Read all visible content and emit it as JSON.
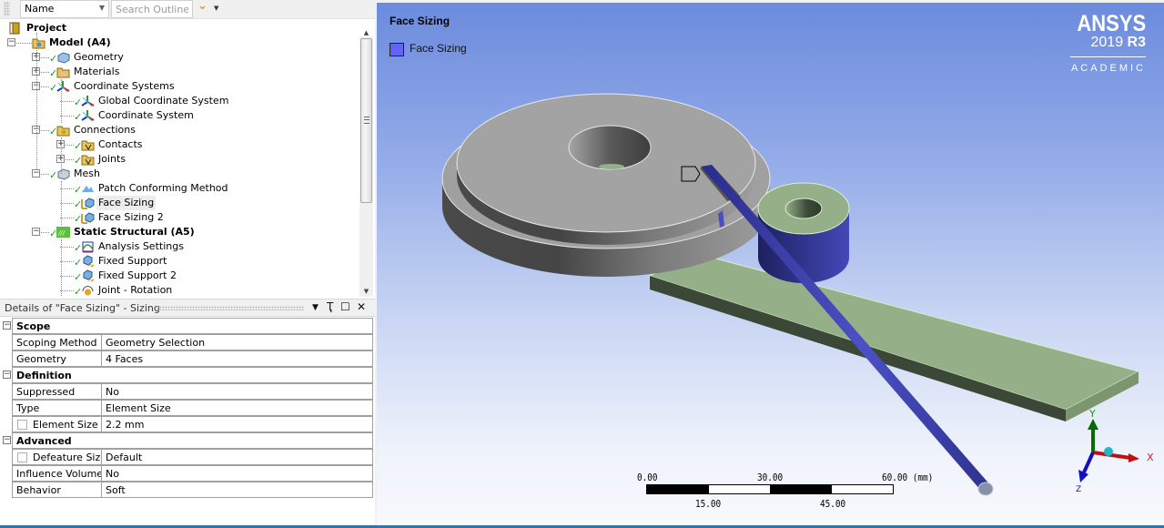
{
  "outline": {
    "name_filter": "Name",
    "search_placeholder": "Search Outline",
    "tree": [
      {
        "label": "Project",
        "level": 0,
        "bold": true,
        "icon": "project-icon",
        "expander": null,
        "check": false
      },
      {
        "label": "Model (A4)",
        "level": 1,
        "bold": true,
        "icon": "model-folder-icon",
        "expander": "minus",
        "check": false
      },
      {
        "label": "Geometry",
        "level": 2,
        "bold": false,
        "icon": "geometry-icon",
        "expander": "plus",
        "check": true
      },
      {
        "label": "Materials",
        "level": 2,
        "bold": false,
        "icon": "materials-icon",
        "expander": "plus",
        "check": true
      },
      {
        "label": "Coordinate Systems",
        "level": 2,
        "bold": false,
        "icon": "coordinate-systems-icon",
        "expander": "minus",
        "check": true
      },
      {
        "label": "Global Coordinate System",
        "level": 3,
        "bold": false,
        "icon": "coordinate-system-icon",
        "expander": null,
        "check": true
      },
      {
        "label": "Coordinate System",
        "level": 3,
        "bold": false,
        "icon": "coordinate-system-icon",
        "expander": null,
        "check": true
      },
      {
        "label": "Connections",
        "level": 2,
        "bold": false,
        "icon": "connections-icon",
        "expander": "minus",
        "check": true
      },
      {
        "label": "Contacts",
        "level": 3,
        "bold": false,
        "icon": "contacts-icon",
        "expander": "plus",
        "check": true
      },
      {
        "label": "Joints",
        "level": 3,
        "bold": false,
        "icon": "joints-icon",
        "expander": "plus",
        "check": true
      },
      {
        "label": "Mesh",
        "level": 2,
        "bold": false,
        "icon": "mesh-icon",
        "expander": "minus",
        "check": true
      },
      {
        "label": "Patch Conforming Method",
        "level": 3,
        "bold": false,
        "icon": "patch-conforming-icon",
        "expander": null,
        "check": true
      },
      {
        "label": "Face Sizing",
        "level": 3,
        "bold": false,
        "icon": "face-sizing-icon",
        "expander": null,
        "check": true,
        "selected": true
      },
      {
        "label": "Face Sizing 2",
        "level": 3,
        "bold": false,
        "icon": "face-sizing-icon",
        "expander": null,
        "check": true
      },
      {
        "label": "Static Structural (A5)",
        "level": 2,
        "bold": true,
        "icon": "static-structural-icon",
        "expander": "minus",
        "check": true
      },
      {
        "label": "Analysis Settings",
        "level": 3,
        "bold": false,
        "icon": "analysis-settings-icon",
        "expander": null,
        "check": true
      },
      {
        "label": "Fixed Support",
        "level": 3,
        "bold": false,
        "icon": "fixed-support-icon",
        "expander": null,
        "check": true
      },
      {
        "label": "Fixed Support 2",
        "level": 3,
        "bold": false,
        "icon": "fixed-support-icon",
        "expander": null,
        "check": true
      },
      {
        "label": "Joint - Rotation",
        "level": 3,
        "bold": false,
        "icon": "joint-rotation-icon",
        "expander": null,
        "check": true
      }
    ]
  },
  "details": {
    "title": "Details of \"Face Sizing\" - Sizing",
    "controls": {
      "dropdown": "▼",
      "pin": "Ҭ",
      "maximize": "☐",
      "close": "✕"
    },
    "groups": [
      {
        "name": "Scope",
        "rows": [
          {
            "key": "Scoping Method",
            "value": "Geometry Selection",
            "checkbox": false
          },
          {
            "key": "Geometry",
            "value": "4 Faces",
            "checkbox": false
          }
        ]
      },
      {
        "name": "Definition",
        "rows": [
          {
            "key": "Suppressed",
            "value": "No",
            "checkbox": false
          },
          {
            "key": "Type",
            "value": "Element Size",
            "checkbox": false
          },
          {
            "key": "Element Size",
            "value": "2.2 mm",
            "checkbox": true
          }
        ]
      },
      {
        "name": "Advanced",
        "rows": [
          {
            "key": "Defeature Size",
            "value": "Default",
            "checkbox": true
          },
          {
            "key": "Influence Volume",
            "value": "No",
            "checkbox": false
          },
          {
            "key": "Behavior",
            "value": "Soft",
            "checkbox": false
          }
        ]
      }
    ]
  },
  "viewport": {
    "title": "Face Sizing",
    "legend": {
      "label": "Face Sizing",
      "color": "#6264f4"
    },
    "logo": {
      "brand": "ANSYS",
      "version": "2019",
      "release": "R3",
      "edition": "ACADEMIC"
    },
    "scale": {
      "top_labels": [
        "0.00",
        "30.00",
        "60.00 (mm)"
      ],
      "bottom_labels": [
        "15.00",
        "45.00"
      ]
    },
    "triad": {
      "x": "X",
      "y": "Y",
      "z": "Z"
    },
    "colors": {
      "selected_body": "#4a4fc0",
      "plate": "#95b088",
      "disc": "#a3a3a3"
    }
  }
}
